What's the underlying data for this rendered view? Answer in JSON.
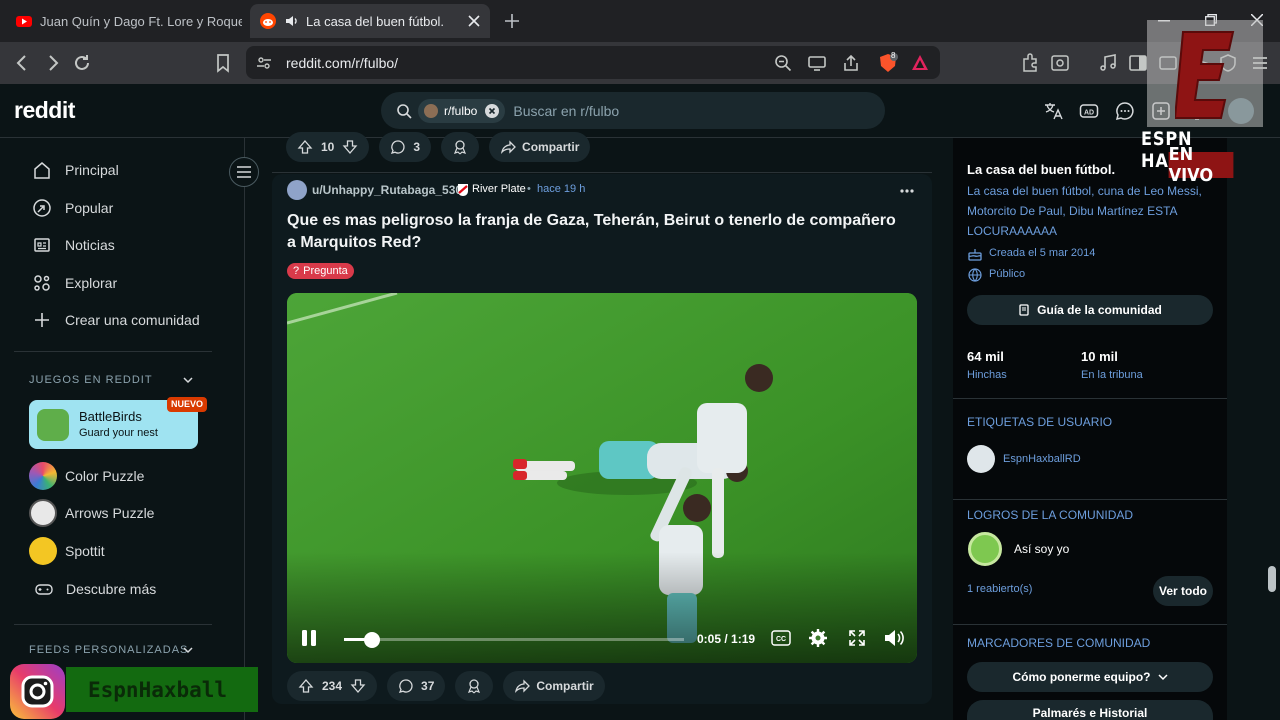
{
  "browser": {
    "tabs": [
      {
        "title": "Juan Quín y Dago Ft. Lore y Roque M",
        "icon": "youtube-icon"
      },
      {
        "title": "La casa del buen fútbol.",
        "icon": "reddit-icon"
      }
    ],
    "url": "reddit.com/r/fulbo/",
    "shield_count": "8"
  },
  "header": {
    "logo": "reddit",
    "search_chip": "r/fulbo",
    "search_placeholder": "Buscar en r/fulbo"
  },
  "sidebar": {
    "nav": [
      "Principal",
      "Popular",
      "Noticias",
      "Explorar",
      "Crear una comunidad"
    ],
    "games_title": "JUEGOS EN REDDIT",
    "featured_game": {
      "title": "BattleBirds",
      "subtitle": "Guard your nest",
      "badge": "NUEVO"
    },
    "games": [
      "Color Puzzle",
      "Arrows Puzzle",
      "Spottit",
      "Descubre más"
    ],
    "feeds_title": "FEEDS PERSONALIZADAS"
  },
  "prev_post": {
    "votes": "10",
    "comments": "3",
    "share": "Compartir"
  },
  "post": {
    "author": "u/Unhappy_Rutabaga_530",
    "flair": "River Plate",
    "time": "hace 19 h",
    "title": "Que es mas peligroso la franja de Gaza, Teherán, Beirut o tenerlo de compañero a Marquitos Red?",
    "tag": "Pregunta",
    "video_time": "0:05 / 1:19",
    "video_progress": 0.04,
    "votes": "234",
    "comments": "37",
    "share": "Compartir"
  },
  "community": {
    "name": "La casa del buen fútbol.",
    "description": "La casa del buen fútbol, cuna de Leo Messi, Motorcito De Paul, Dibu Martínez ESTA LOCURAAAAAA",
    "created": "Creada el 5 mar 2014",
    "visibility": "Público",
    "guide_button": "Guía de la comunidad",
    "members": "64 mil",
    "members_label": "Hinchas",
    "online": "10 mil",
    "online_label": "En la tribuna",
    "user_flair_title": "ETIQUETAS DE USUARIO",
    "user_flair": "EspnHaxballRD",
    "achievements_title": "LOGROS DE LA COMUNIDAD",
    "achievement": "Así soy yo",
    "unlocked": "1 reabierto(s)",
    "see_all": "Ver todo",
    "bookmarks_title": "MARCADORES DE COMUNIDAD",
    "bookmarks": [
      "Cómo ponerme equipo?",
      "Palmarés e Historial"
    ]
  },
  "overlay": {
    "brand": "ESPN HAXBALL",
    "live": "EN VIVO",
    "instagram": "EspnHaxball"
  },
  "colors": {
    "accent": "#6d9edd",
    "badge_red": "#d93a00",
    "field_green": "#3f9a2c"
  }
}
